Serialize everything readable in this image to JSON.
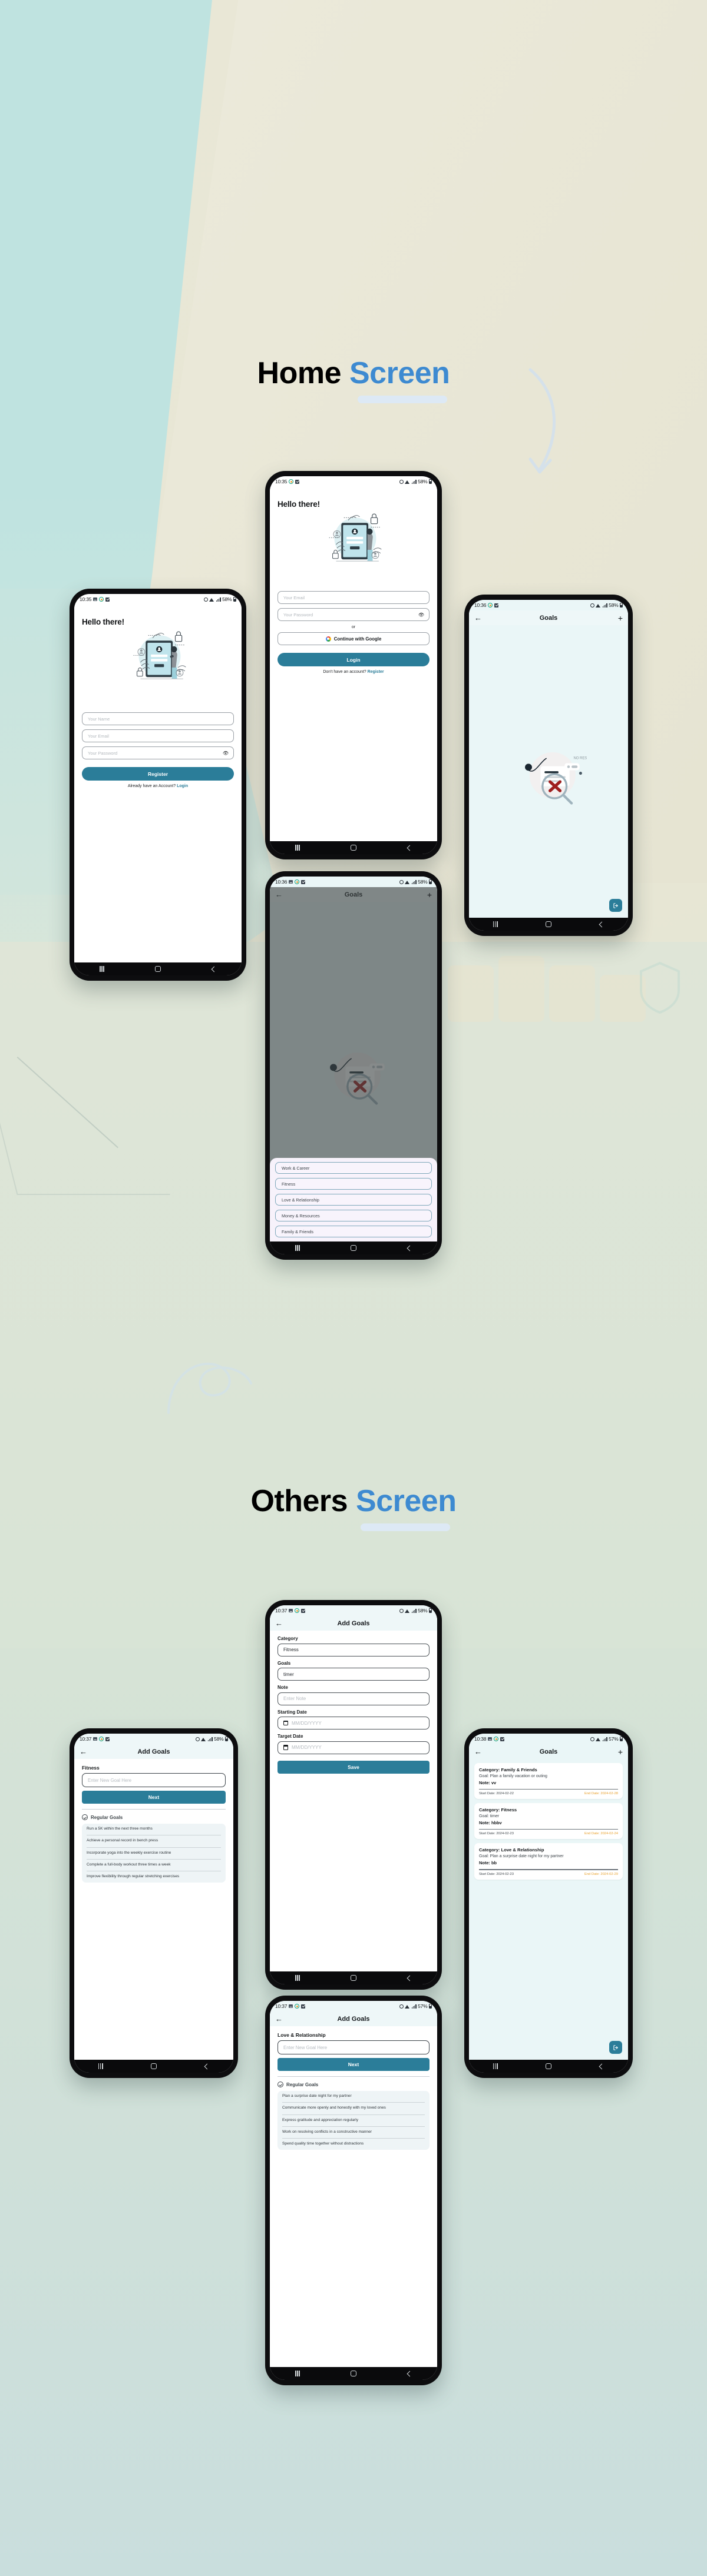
{
  "sections": {
    "home": {
      "title_dark": "Home",
      "title_blue": "Screen"
    },
    "others": {
      "title_dark": "Others",
      "title_blue": "Screen"
    }
  },
  "colors": {
    "primary": "#2b7d99",
    "accent_blue": "#3d8ad1",
    "end_date": "#e8a02c",
    "sheet_bg": "#f7f2fb"
  },
  "nav": {
    "recents": "recents-icon",
    "home": "home-icon",
    "back": "back-icon"
  },
  "status_bars": {
    "s1035_full": {
      "time": "10:35",
      "battery": "58%"
    },
    "s1035": {
      "time": "10:35",
      "battery": "58%"
    },
    "s1036": {
      "time": "10:36",
      "battery": "58%"
    },
    "s1037": {
      "time": "10:37",
      "battery": "58%"
    },
    "s1037b": {
      "time": "10:37",
      "battery": "57%"
    },
    "s1038": {
      "time": "10:38",
      "battery": "57%"
    }
  },
  "register_screen": {
    "heading": "Hello there!",
    "fields": [
      {
        "placeholder": "Your Name",
        "eye": false
      },
      {
        "placeholder": "Your Email",
        "eye": false
      },
      {
        "placeholder": "Your Password",
        "eye": true
      }
    ],
    "submit": "Register",
    "footer_text": "Already have an Account?",
    "footer_link": "Login"
  },
  "login_screen": {
    "heading": "Hello there!",
    "fields": [
      {
        "placeholder": "Your Email",
        "eye": false
      },
      {
        "placeholder": "Your Password",
        "eye": true
      }
    ],
    "or": "or",
    "google_button": "Continue with Google",
    "submit": "Login",
    "footer_text": "Don't have an account?",
    "footer_link": "Register"
  },
  "goals_empty": {
    "title": "Goals",
    "back": "←",
    "plus": "+"
  },
  "category_sheet": {
    "title": "Goals",
    "back": "←",
    "plus": "+",
    "items": [
      "Work & Career",
      "Fitness",
      "Love & Relationship",
      "Money & Resources",
      "Family & Friends"
    ]
  },
  "add_goals_form": {
    "title": "Add Goals",
    "back": "←",
    "labels": {
      "category": "Category",
      "goals": "Goals",
      "note": "Note",
      "start": "Starting Date",
      "target": "Target Date"
    },
    "values": {
      "category": "Fitness",
      "goals": "timer"
    },
    "placeholders": {
      "note": "Enter Note",
      "start": "MM/DD/YYYY",
      "target": "MM/DD/YYYY"
    },
    "save": "Save"
  },
  "add_goals_fitness": {
    "title": "Add Goals",
    "back": "←",
    "category": "Fitness",
    "input_placeholder": "Enter New Goal Here",
    "next": "Next",
    "regular_label": "Regular Goals",
    "regular_goals": [
      "Run a 5K within the next three months",
      "Achieve a personal record in bench press",
      "Incorporate yoga into the weekly exercise routine",
      "Complete a full-body workout three times a week",
      "Improve flexibility through regular stretching exercises"
    ]
  },
  "add_goals_love": {
    "title": "Add Goals",
    "back": "←",
    "category": "Love & Relationship",
    "input_placeholder": "Enter New Goal Here",
    "next": "Next",
    "regular_label": "Regular Goals",
    "regular_goals": [
      "Plan a surprise date night for my partner",
      "Communicate more openly and honestly with my loved ones",
      "Express gratitude and appreciation regularly",
      "Work on resolving conflicts in a constructive manner",
      "Spend quality time together without distractions"
    ]
  },
  "goals_list": {
    "title": "Goals",
    "back": "←",
    "plus": "+",
    "fab_icon": "logout-icon",
    "cards": [
      {
        "category": "Category: Family & Friends",
        "goal": "Goal: Plan a family vacation or outing",
        "note": "Note: vv",
        "start": "Start Date: 2024-02-22",
        "end": "End Date: 2024-02-28"
      },
      {
        "category": "Category: Fitness",
        "goal": "Goal: timer",
        "note": "Note: hbbv",
        "start": "Start Date: 2024-02-23",
        "end": "End Date: 2024-02-24"
      },
      {
        "category": "Category: Love & Relationship",
        "goal": "Goal: Plan a surprise date night for my partner",
        "note": "Note: bb",
        "start": "Start Date: 2024-02-23",
        "end": "End Date: 2024-02-29"
      }
    ]
  }
}
